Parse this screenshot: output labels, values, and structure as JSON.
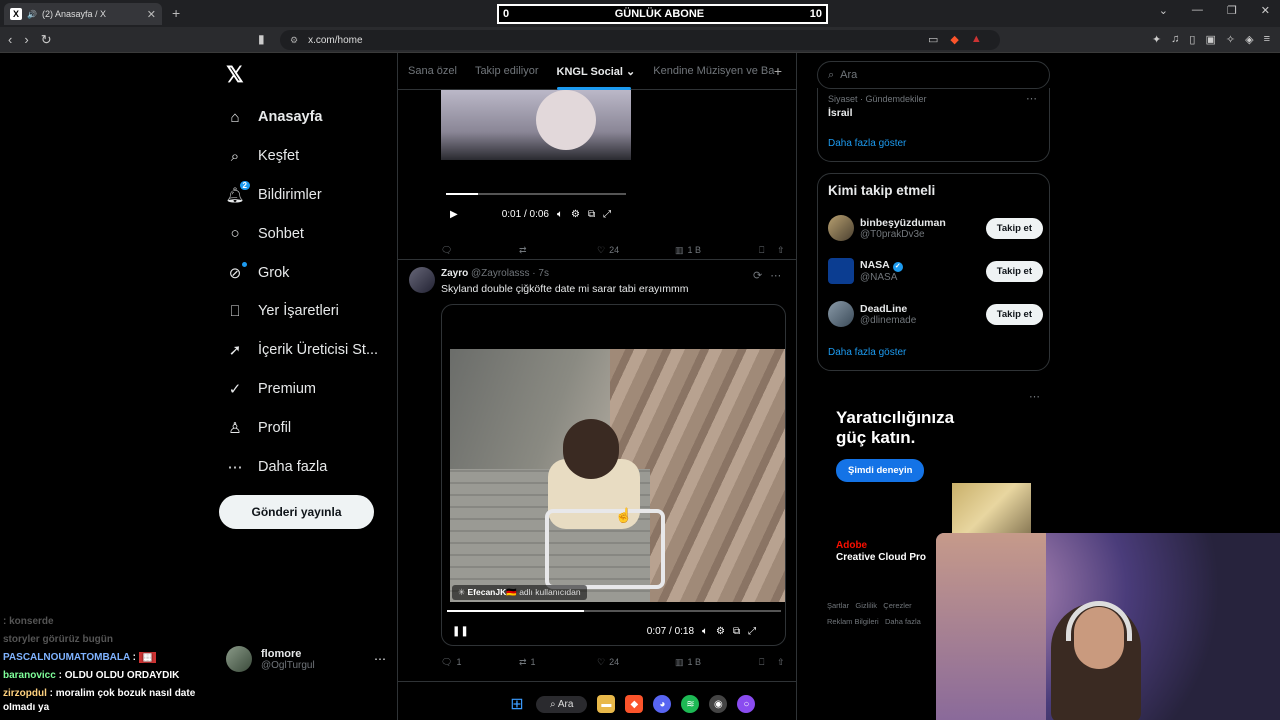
{
  "browser": {
    "tab_title": "(2) Anasayfa / X",
    "tab_favicon": "X",
    "url": "x.com/home",
    "overlay_left": "0",
    "overlay_title": "GÜNLÜK ABONE",
    "overlay_right": "10"
  },
  "sidebar": {
    "logo": "𝕏",
    "items": [
      {
        "label": "Anasayfa",
        "icon": "home-icon"
      },
      {
        "label": "Keşfet",
        "icon": "search-icon"
      },
      {
        "label": "Bildirimler",
        "icon": "bell-icon",
        "badge": "2"
      },
      {
        "label": "Sohbet",
        "icon": "chat-icon"
      },
      {
        "label": "Grok",
        "icon": "grok-icon"
      },
      {
        "label": "Yer İşaretleri",
        "icon": "bookmark-icon"
      },
      {
        "label": "İçerik Üreticisi St...",
        "icon": "rocket-icon"
      },
      {
        "label": "Premium",
        "icon": "premium-icon"
      },
      {
        "label": "Profil",
        "icon": "profile-icon"
      },
      {
        "label": "Daha fazla",
        "icon": "more-icon"
      }
    ],
    "post_button": "Gönderi yayınla",
    "account": {
      "name": "flomore",
      "handle": "@OglTurgul"
    }
  },
  "feed": {
    "tabs": [
      "Sana özel",
      "Takip ediliyor",
      "KNGL Social",
      "Kendine Müzisyen ve Ba"
    ],
    "active_tab": "KNGL Social",
    "tweet1": {
      "time": "0:01 / 0:06",
      "progress": 0.18,
      "replies": "",
      "retweets": "",
      "likes": "24",
      "views": "1 B"
    },
    "tweet2": {
      "name": "Zayro",
      "handle": "@Zayrolasss",
      "time_ago": "· 7s",
      "text": "Skyland double çiğköfte date mi sarar tabi erayımmm",
      "credit_user": "EfecanJK🇩🇪",
      "credit_suffix": "adlı kullanıcıdan",
      "video_time": "0:07 / 0:18",
      "progress": 0.41,
      "replies": "1",
      "retweets": "1",
      "likes": "24",
      "views": "1 B"
    }
  },
  "right": {
    "search_placeholder": "Ara",
    "trend": {
      "category": "Siyaset · Gündemdekiler",
      "name": "İsrail",
      "show_more": "Daha fazla göster"
    },
    "who_to_follow": {
      "title": "Kimi takip etmeli",
      "users": [
        {
          "name": "binbeşyüzduman",
          "handle": "@T0prakDv3e",
          "verified": false
        },
        {
          "name": "NASA",
          "handle": "@NASA",
          "verified": true
        },
        {
          "name": "DeadLine",
          "handle": "@dlinemade",
          "verified": false
        }
      ],
      "follow_label": "Takip et",
      "show_more": "Daha fazla göster"
    },
    "ad": {
      "headline": "Yaratıcılığınıza güç katın.",
      "button": "Şimdi deneyin",
      "brand": "Adobe",
      "product": "Creative Cloud Pro"
    },
    "footer": [
      "Şartlar",
      "Gizlilik",
      "Çerezler",
      "Reklam Bilgileri",
      "Daha fazla"
    ]
  },
  "chat": [
    {
      "user": "",
      "text": ": konserde",
      "faded": true
    },
    {
      "user": "",
      "text": "storyler görürüz bugün",
      "faded": true
    },
    {
      "user": "PASCALNOUMATOMBALA",
      "text": ":",
      "color": "#7fb3ff"
    },
    {
      "user": "baranovicc",
      "text": ": OLDU OLDU ORDAYDIK",
      "color": "#7fff9a"
    },
    {
      "user": "zirzopdul",
      "text": ": moralim çok bozuk nasıl date",
      "color": "#ffd27f"
    },
    {
      "user": "",
      "text": "olmadı ya",
      "faded": false
    }
  ],
  "taskbar": {
    "search": "Ara"
  }
}
